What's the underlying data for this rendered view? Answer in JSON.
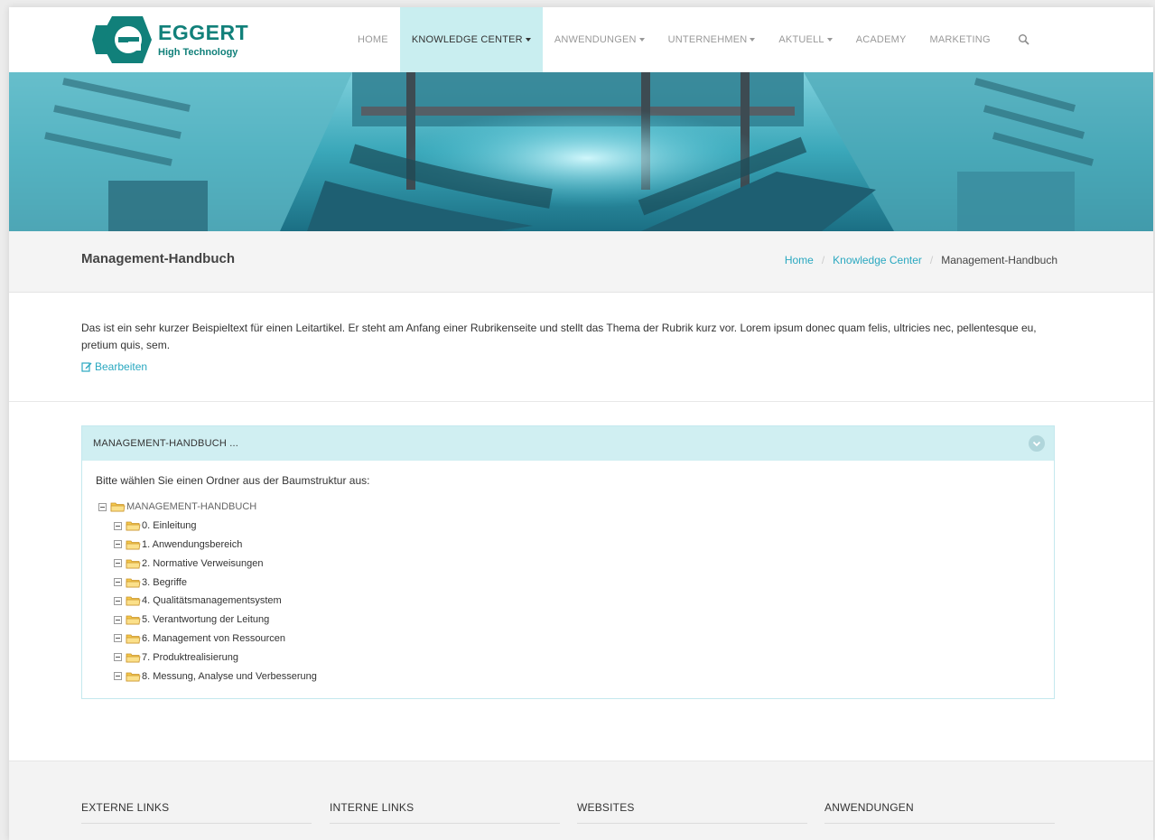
{
  "brand": {
    "name": "EGGERT",
    "tagline": "High Technology",
    "color": "#11807a"
  },
  "nav": {
    "items": [
      {
        "label": "HOME",
        "active": false,
        "dropdown": false
      },
      {
        "label": "KNOWLEDGE CENTER",
        "active": true,
        "dropdown": true
      },
      {
        "label": "ANWENDUNGEN",
        "active": false,
        "dropdown": true
      },
      {
        "label": "UNTERNEHMEN",
        "active": false,
        "dropdown": true
      },
      {
        "label": "AKTUELL",
        "active": false,
        "dropdown": true
      },
      {
        "label": "ACADEMY",
        "active": false,
        "dropdown": false
      },
      {
        "label": "MARKETING",
        "active": false,
        "dropdown": false
      }
    ],
    "search_icon": "search-icon",
    "active_bg": "#c9eef0"
  },
  "page": {
    "title": "Management-Handbuch",
    "breadcrumb": {
      "home": "Home",
      "section": "Knowledge Center",
      "current": "Management-Handbuch"
    }
  },
  "intro": {
    "text": "Das ist ein sehr kurzer Beispieltext für einen Leitartikel. Er steht am Anfang einer Rubrikenseite und stellt das Thema der Rubrik kurz vor. Lorem ipsum donec quam felis, ultricies nec, pellentesque eu, pretium quis, sem.",
    "edit_label": "Bearbeiten"
  },
  "panel": {
    "title": "MANAGEMENT-HANDBUCH ...",
    "prompt": "Bitte wählen Sie einen Ordner aus der Baumstruktur aus:",
    "root": "MANAGEMENT-HANDBUCH",
    "children": [
      "0. Einleitung",
      "1. Anwendungsbereich",
      "2. Normative Verweisungen",
      "3. Begriffe",
      "4. Qualitätsmanagementsystem",
      "5. Verantwortung der Leitung",
      "6. Management von Ressourcen",
      "7. Produktrealisierung",
      "8. Messung, Analyse und Verbesserung"
    ]
  },
  "footer": {
    "columns": [
      "EXTERNE LINKS",
      "INTERNE LINKS",
      "WEBSITES",
      "ANWENDUNGEN"
    ]
  },
  "colors": {
    "link": "#2aa8c0",
    "panel_head": "#d0eff2",
    "hero": "#2a9fb0"
  }
}
